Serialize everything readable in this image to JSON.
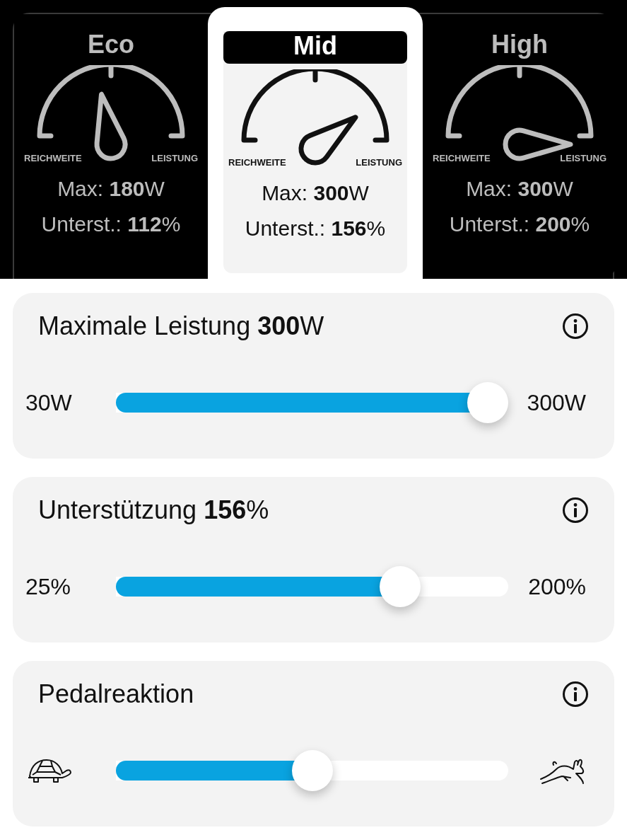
{
  "modes": [
    {
      "title": "Eco",
      "selected": false,
      "gauge": {
        "left_label": "REICHWEITE",
        "right_label": "LEISTUNG"
      },
      "max": "Max: **180**W",
      "support": "Unterst.: **112**%"
    },
    {
      "title": "Mid",
      "selected": true,
      "gauge": {
        "left_label": "REICHWEITE",
        "right_label": "LEISTUNG"
      },
      "max": "Max: **300**W",
      "support": "Unterst.: **156**%"
    },
    {
      "title": "High",
      "selected": false,
      "gauge": {
        "left_label": "REICHWEITE",
        "right_label": "LEISTUNG"
      },
      "max": "Max: **300**W",
      "support": "Unterst.: **200**%"
    }
  ],
  "settings": [
    {
      "title": "Maximale Leistung **300**W",
      "kind": "text",
      "min": "30W",
      "max": "300W",
      "level": 1
    },
    {
      "title": "Unterstützung **156**%",
      "kind": "text",
      "min": "25%",
      "max": "200%",
      "level": 0.75
    },
    {
      "title": "Pedalreaktion",
      "kind": "icon",
      "level": 0.5
    }
  ]
}
